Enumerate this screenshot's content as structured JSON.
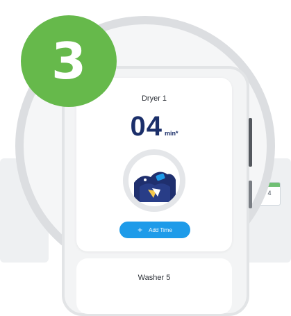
{
  "step_badge": {
    "number": "3",
    "color": "#66b94b"
  },
  "dryer_card": {
    "name": "Dryer 1",
    "remaining_time": "04",
    "unit": "min*",
    "add_time_label": "Add Time",
    "animation_icon": "dryer-drum-icon"
  },
  "washer_card": {
    "name": "Washer 5"
  },
  "side_card": {
    "number": "4"
  },
  "colors": {
    "accent": "#1e9be9",
    "time_text": "#1b2f6a"
  }
}
